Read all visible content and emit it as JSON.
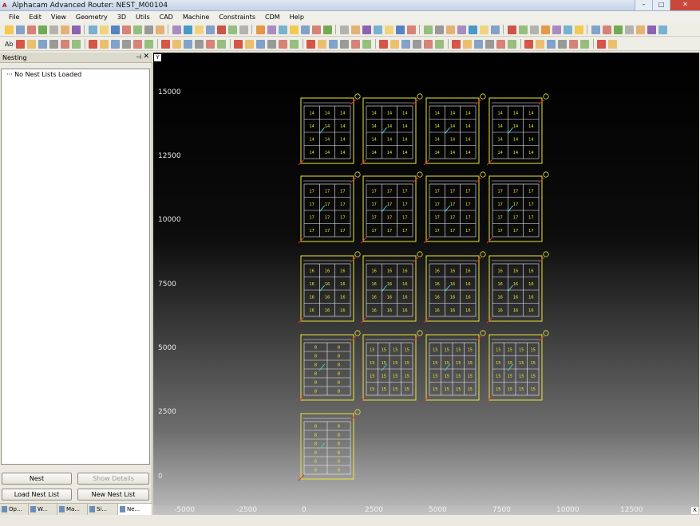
{
  "window": {
    "title": "Alphacam Advanced Router: NEST_M00104",
    "icon": "alphacam-icon",
    "controls": [
      "minimize-icon",
      "maximize-icon",
      "close-icon"
    ]
  },
  "menu": [
    "File",
    "Edit",
    "View",
    "Geometry",
    "3D",
    "Utils",
    "CAD",
    "Machine",
    "Constraints",
    "CDM",
    "Help"
  ],
  "toolbar1": {
    "count": 56,
    "colors": [
      "#f3c23a",
      "#3a6fb8",
      "#c43a2e",
      "#5a9e3a",
      "#8a8a8a",
      "#e08a2a",
      "#7a4aa8",
      "#2a8ac0"
    ]
  },
  "toolbar2": {
    "label": "Ab",
    "count": 50,
    "colors": [
      "#d03a2a",
      "#e8a020",
      "#3a6fb8",
      "#8a8a8a",
      "#c43a2e",
      "#5a9e3a"
    ]
  },
  "panel": {
    "title": "Nesting",
    "pin": "pin-icon",
    "close": "close-icon",
    "tree_item": "No Nest Lists Loaded",
    "buttons": {
      "nest": "Nest",
      "show_details": "Show Details",
      "load_nest_list": "Load Nest List",
      "new_nest_list": "New Nest List"
    },
    "tabs": [
      "Op...",
      "W...",
      "Ma...",
      "Si...",
      "Ne..."
    ]
  },
  "canvas": {
    "y_marker": "Y",
    "x_marker": "X",
    "y_ticks": [
      "15000",
      "12500",
      "10000",
      "7500",
      "5000",
      "2500",
      "0"
    ],
    "x_ticks": [
      "-5000",
      "-2500",
      "0",
      "2500",
      "5000",
      "7500",
      "10000",
      "12500"
    ],
    "sheet_color": "#e8e83a",
    "part_color": "#f0f0f0",
    "toolpath_color": "#e03030",
    "lead_color": "#3ad0c0",
    "sheet_rows": [
      {
        "labels": [
          "14",
          "14",
          "14",
          "14"
        ]
      },
      {
        "labels": [
          "17",
          "17",
          "17",
          "17"
        ]
      },
      {
        "labels": [
          "16",
          "16",
          "16",
          "16"
        ]
      },
      {
        "labels": [
          "8",
          "15",
          "15",
          "15"
        ]
      },
      {
        "labels": [
          "8"
        ]
      }
    ]
  }
}
